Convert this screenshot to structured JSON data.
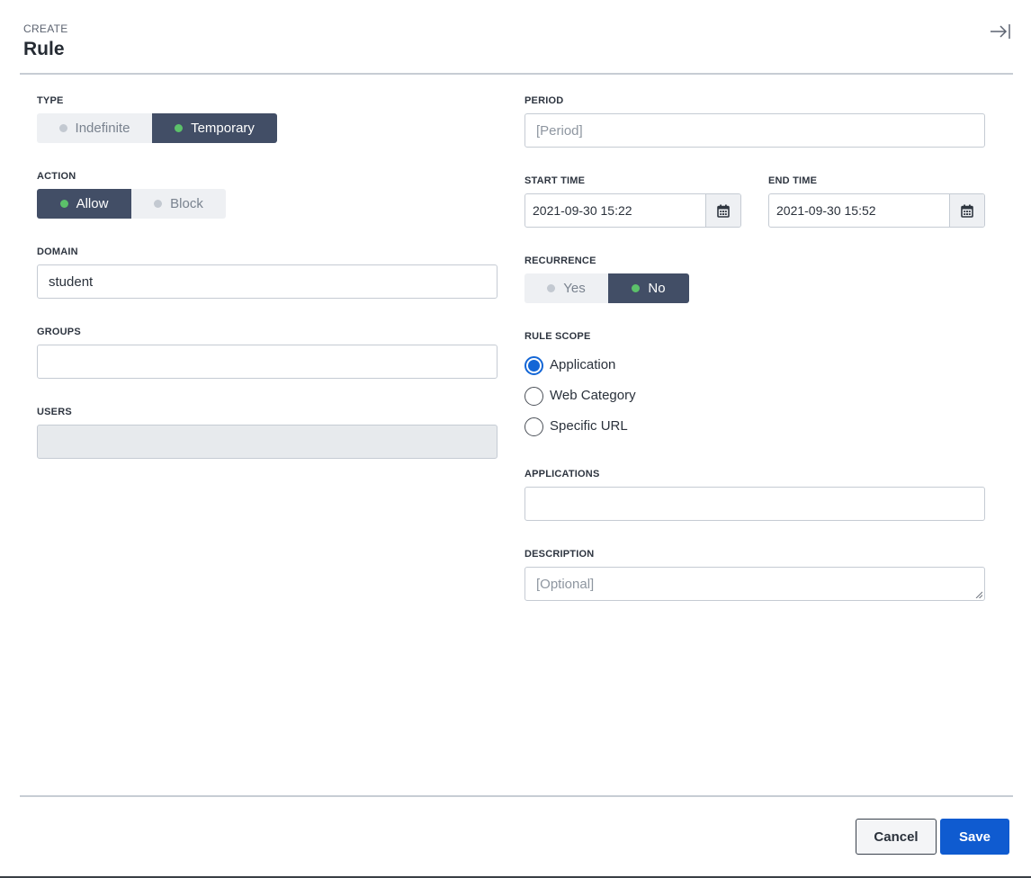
{
  "header": {
    "eyebrow": "CREATE",
    "title": "Rule"
  },
  "type": {
    "label": "TYPE",
    "options": [
      {
        "label": "Indefinite",
        "active": false
      },
      {
        "label": "Temporary",
        "active": true
      }
    ]
  },
  "action": {
    "label": "ACTION",
    "options": [
      {
        "label": "Allow",
        "active": true
      },
      {
        "label": "Block",
        "active": false
      }
    ]
  },
  "domain": {
    "label": "DOMAIN",
    "value": "student"
  },
  "groups": {
    "label": "GROUPS",
    "value": ""
  },
  "users": {
    "label": "USERS",
    "value": ""
  },
  "period": {
    "label": "PERIOD",
    "placeholder": "[Period]"
  },
  "start_time": {
    "label": "START TIME",
    "value": "2021-09-30 15:22"
  },
  "end_time": {
    "label": "END TIME",
    "value": "2021-09-30 15:52"
  },
  "recurrence": {
    "label": "RECURRENCE",
    "options": [
      {
        "label": "Yes",
        "active": false
      },
      {
        "label": "No",
        "active": true
      }
    ]
  },
  "rule_scope": {
    "label": "RULE SCOPE",
    "options": [
      {
        "label": "Application",
        "checked": true
      },
      {
        "label": "Web Category",
        "checked": false
      },
      {
        "label": "Specific URL",
        "checked": false
      }
    ]
  },
  "applications": {
    "label": "APPLICATIONS",
    "value": ""
  },
  "description": {
    "label": "DESCRIPTION",
    "placeholder": "[Optional]"
  },
  "footer": {
    "cancel_label": "Cancel",
    "save_label": "Save"
  },
  "colors": {
    "toggle_active": "#424e66",
    "dot_active": "#5cc16a",
    "primary": "#0f5bd0",
    "radio_checked": "#1366d6"
  },
  "icons": {
    "collapse": "collapse-panel-icon",
    "calendar": "calendar-icon"
  }
}
